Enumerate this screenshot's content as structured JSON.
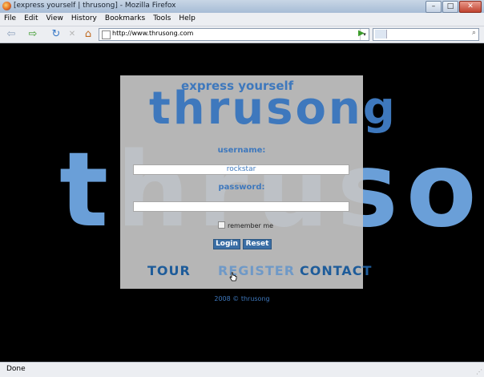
{
  "window": {
    "title": "[express yourself | thrusong] - Mozilla Firefox",
    "buttons": {
      "minimize": "–",
      "maximize": "□",
      "close": "✕"
    }
  },
  "menubar": {
    "items": [
      {
        "label": "File"
      },
      {
        "label": "Edit"
      },
      {
        "label": "View"
      },
      {
        "label": "History"
      },
      {
        "label": "Bookmarks"
      },
      {
        "label": "Tools"
      },
      {
        "label": "Help"
      }
    ]
  },
  "navbar": {
    "back": "⇦",
    "forward": "⇨",
    "reload": "↻",
    "stop": "✕",
    "home": "⌂",
    "url": "http://www.thrusong.com",
    "dropdown": "▾",
    "go": "▶",
    "search_value": "",
    "search_icon": "⌕"
  },
  "page": {
    "background_word": "thrusong",
    "tagline": "express yourself",
    "logo": "thrusong",
    "username_label": "username:",
    "username_value": "rockstar",
    "password_label": "password:",
    "password_value": "",
    "remember_label": "remember me",
    "login_label": "Login",
    "reset_label": "Reset",
    "nav": {
      "tour": "TOUR",
      "register": "REGISTER",
      "contact": "CONTACT"
    },
    "footer": "2008 © thrusong"
  },
  "status": {
    "text": "Done"
  },
  "colors": {
    "brand_blue": "#3e78bd",
    "bg_blue": "#6a9fd8",
    "panel_gray": "#c4c4c4",
    "page_bg": "#000000"
  }
}
